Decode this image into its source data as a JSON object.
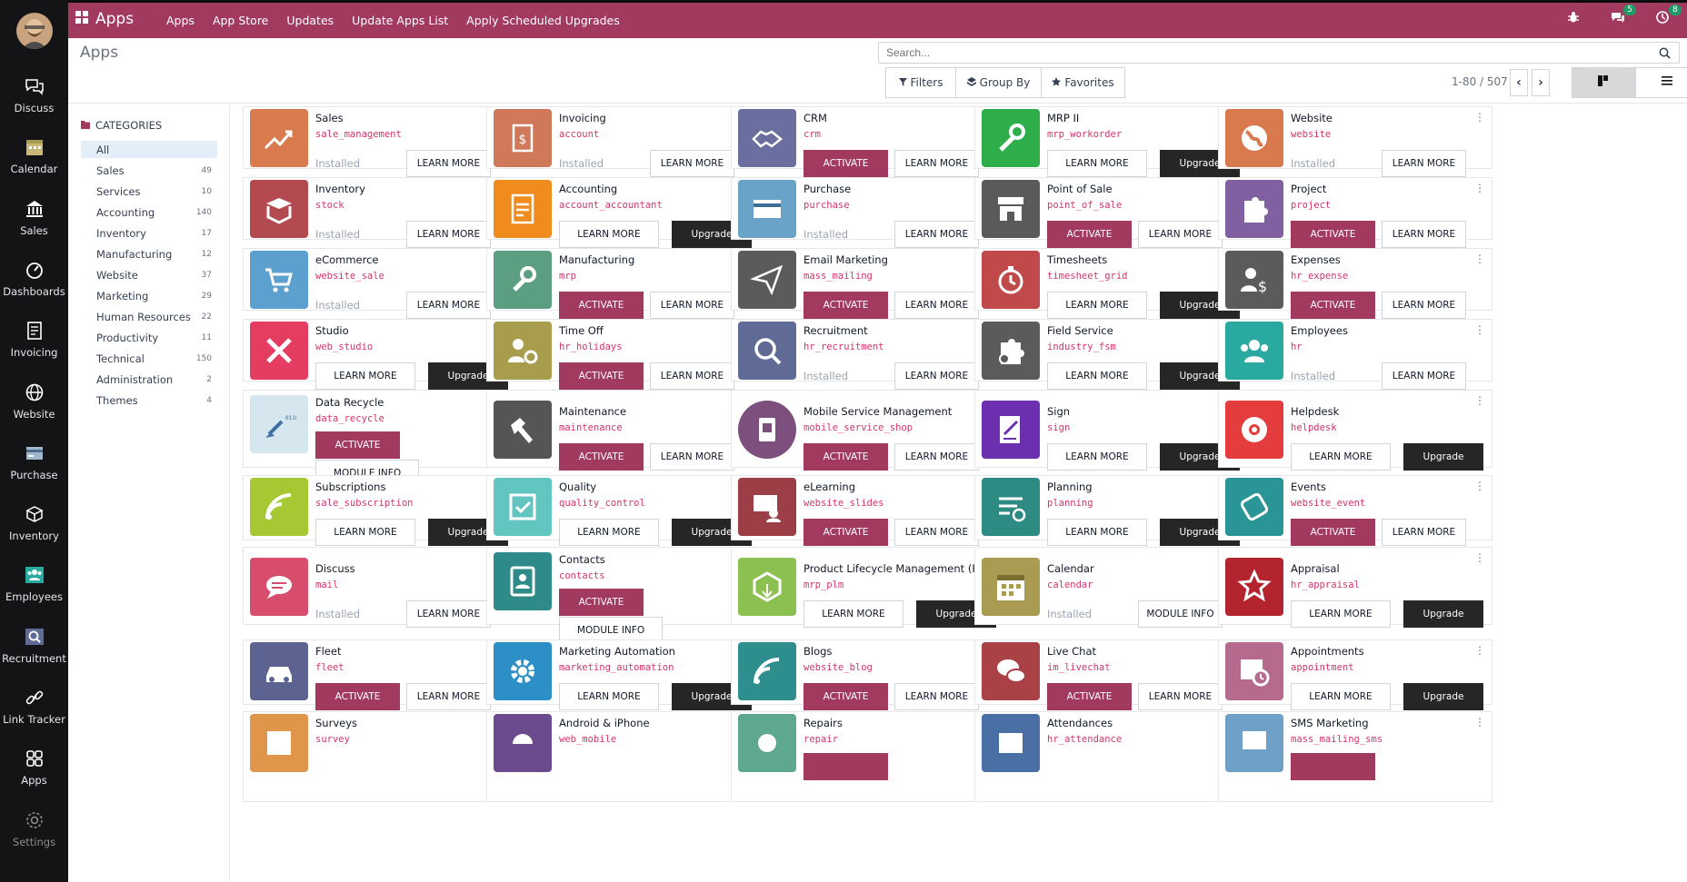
{
  "topbar": {
    "brand": "Apps",
    "nav": [
      "Apps",
      "App Store",
      "Updates",
      "Update Apps List",
      "Apply Scheduled Upgrades"
    ],
    "chat_badge": "5",
    "activity_badge": "8"
  },
  "leftbar": [
    {
      "label": "Discuss",
      "icon": "chat-icon"
    },
    {
      "label": "Calendar",
      "icon": "calendar-icon"
    },
    {
      "label": "Sales",
      "icon": "bank-icon"
    },
    {
      "label": "Dashboards",
      "icon": "gauge-icon"
    },
    {
      "label": "Invoicing",
      "icon": "invoice-icon"
    },
    {
      "label": "Website",
      "icon": "globe-icon"
    },
    {
      "label": "Purchase",
      "icon": "card-icon"
    },
    {
      "label": "Inventory",
      "icon": "box-icon"
    },
    {
      "label": "Employees",
      "icon": "people-icon"
    },
    {
      "label": "Recruitment",
      "icon": "search-icon"
    },
    {
      "label": "Link Tracker",
      "icon": "link-icon"
    },
    {
      "label": "Apps",
      "icon": "grid-icon"
    },
    {
      "label": "Settings",
      "icon": "gear-icon"
    }
  ],
  "breadcrumb": "Apps",
  "search": {
    "placeholder": "Search..."
  },
  "filters": {
    "filters": "Filters",
    "groupby": "Group By",
    "favorites": "Favorites"
  },
  "pager": "1-80 / 507",
  "sidebar": {
    "heading": "CATEGORIES",
    "items": [
      {
        "label": "All",
        "count": ""
      },
      {
        "label": "Sales",
        "count": "49"
      },
      {
        "label": "Services",
        "count": "10"
      },
      {
        "label": "Accounting",
        "count": "140"
      },
      {
        "label": "Inventory",
        "count": "17"
      },
      {
        "label": "Manufacturing",
        "count": "12"
      },
      {
        "label": "Website",
        "count": "37"
      },
      {
        "label": "Marketing",
        "count": "29"
      },
      {
        "label": "Human Resources",
        "count": "22"
      },
      {
        "label": "Productivity",
        "count": "11"
      },
      {
        "label": "Technical",
        "count": "150"
      },
      {
        "label": "Administration",
        "count": "2"
      },
      {
        "label": "Themes",
        "count": "4"
      }
    ]
  },
  "apps": [
    {
      "title": "Sales",
      "tech": "sale_management",
      "status": "installed",
      "b1": "Installed",
      "b2": "LEARN MORE",
      "color": "#d97b4f"
    },
    {
      "title": "Invoicing",
      "tech": "account",
      "status": "installed",
      "b1": "Installed",
      "b2": "LEARN MORE",
      "color": "#d0785a"
    },
    {
      "title": "CRM",
      "tech": "crm",
      "status": "activate",
      "b1": "ACTIVATE",
      "b2": "LEARN MORE",
      "color": "#6a6fa0"
    },
    {
      "title": "MRP II",
      "tech": "mrp_workorder",
      "status": "upgrade",
      "b1": "LEARN MORE",
      "b2": "Upgrade",
      "color": "#2eae4b"
    },
    {
      "title": "Website",
      "tech": "website",
      "status": "installed",
      "b1": "Installed",
      "b2": "LEARN MORE",
      "color": "#d87a4d"
    },
    {
      "title": "Inventory",
      "tech": "stock",
      "status": "installed",
      "b1": "Installed",
      "b2": "LEARN MORE",
      "color": "#b34a4f"
    },
    {
      "title": "Accounting",
      "tech": "account_accountant",
      "status": "upgrade",
      "b1": "LEARN MORE",
      "b2": "Upgrade",
      "color": "#f08c1e"
    },
    {
      "title": "Purchase",
      "tech": "purchase",
      "status": "installed",
      "b1": "Installed",
      "b2": "LEARN MORE",
      "color": "#69a4c8"
    },
    {
      "title": "Point of Sale",
      "tech": "point_of_sale",
      "status": "activate",
      "b1": "ACTIVATE",
      "b2": "LEARN MORE",
      "color": "#5a5a5a"
    },
    {
      "title": "Project",
      "tech": "project",
      "status": "activate",
      "b1": "ACTIVATE",
      "b2": "LEARN MORE",
      "color": "#8060a0"
    },
    {
      "title": "eCommerce",
      "tech": "website_sale",
      "status": "installed",
      "b1": "Installed",
      "b2": "LEARN MORE",
      "color": "#5ba0cf"
    },
    {
      "title": "Manufacturing",
      "tech": "mrp",
      "status": "activate",
      "b1": "ACTIVATE",
      "b2": "LEARN MORE",
      "color": "#5c9e82"
    },
    {
      "title": "Email Marketing",
      "tech": "mass_mailing",
      "status": "activate",
      "b1": "ACTIVATE",
      "b2": "LEARN MORE",
      "color": "#5b5b5b"
    },
    {
      "title": "Timesheets",
      "tech": "timesheet_grid",
      "status": "upgrade",
      "b1": "LEARN MORE",
      "b2": "Upgrade",
      "color": "#c04a4a"
    },
    {
      "title": "Expenses",
      "tech": "hr_expense",
      "status": "activate",
      "b1": "ACTIVATE",
      "b2": "LEARN MORE",
      "color": "#5b5b5b"
    },
    {
      "title": "Studio",
      "tech": "web_studio",
      "status": "upgrade",
      "b1": "LEARN MORE",
      "b2": "Upgrade",
      "color": "#e53d62"
    },
    {
      "title": "Time Off",
      "tech": "hr_holidays",
      "status": "activate",
      "b1": "ACTIVATE",
      "b2": "LEARN MORE",
      "color": "#a89c4d"
    },
    {
      "title": "Recruitment",
      "tech": "hr_recruitment",
      "status": "installed",
      "b1": "Installed",
      "b2": "LEARN MORE",
      "color": "#5f6a95"
    },
    {
      "title": "Field Service",
      "tech": "industry_fsm",
      "status": "upgrade",
      "b1": "LEARN MORE",
      "b2": "Upgrade",
      "color": "#5b5b5b"
    },
    {
      "title": "Employees",
      "tech": "hr",
      "status": "installed",
      "b1": "Installed",
      "b2": "LEARN MORE",
      "color": "#2aa9a0"
    },
    {
      "title": "Data Recycle",
      "tech": "data_recycle",
      "status": "activate-info",
      "b1": "ACTIVATE",
      "b2": "MODULE INFO",
      "color": "#d5e6ee"
    },
    {
      "title": "Maintenance",
      "tech": "maintenance",
      "status": "activate",
      "b1": "ACTIVATE",
      "b2": "LEARN MORE",
      "color": "#555555"
    },
    {
      "title": "Mobile Service Management",
      "tech": "mobile_service_shop",
      "status": "activate",
      "b1": "ACTIVATE",
      "b2": "LEARN MORE",
      "color": "#7c4f7c"
    },
    {
      "title": "Sign",
      "tech": "sign",
      "status": "upgrade",
      "b1": "LEARN MORE",
      "b2": "Upgrade",
      "color": "#6b2fb0"
    },
    {
      "title": "Helpdesk",
      "tech": "helpdesk",
      "status": "upgrade",
      "b1": "LEARN MORE",
      "b2": "Upgrade",
      "color": "#e53d3d"
    },
    {
      "title": "Subscriptions",
      "tech": "sale_subscription",
      "status": "upgrade",
      "b1": "LEARN MORE",
      "b2": "Upgrade",
      "color": "#a6c832"
    },
    {
      "title": "Quality",
      "tech": "quality_control",
      "status": "upgrade",
      "b1": "LEARN MORE",
      "b2": "Upgrade",
      "color": "#63c5bf"
    },
    {
      "title": "eLearning",
      "tech": "website_slides",
      "status": "activate",
      "b1": "ACTIVATE",
      "b2": "LEARN MORE",
      "color": "#9c3e45"
    },
    {
      "title": "Planning",
      "tech": "planning",
      "status": "upgrade",
      "b1": "LEARN MORE",
      "b2": "Upgrade",
      "color": "#2e8b84"
    },
    {
      "title": "Events",
      "tech": "website_event",
      "status": "activate",
      "b1": "ACTIVATE",
      "b2": "LEARN MORE",
      "color": "#2a9596"
    },
    {
      "title": "Discuss",
      "tech": "mail",
      "status": "installed",
      "b1": "Installed",
      "b2": "LEARN MORE",
      "color": "#d84d6c"
    },
    {
      "title": "Contacts",
      "tech": "contacts",
      "status": "activate-info",
      "b1": "ACTIVATE",
      "b2": "MODULE INFO",
      "color": "#2f8a8a"
    },
    {
      "title": "Product Lifecycle Management (PL...",
      "tech": "mrp_plm",
      "status": "upgrade",
      "b1": "LEARN MORE",
      "b2": "Upgrade",
      "color": "#8cc152"
    },
    {
      "title": "Calendar",
      "tech": "calendar",
      "status": "installed-info",
      "b1": "Installed",
      "b2": "MODULE INFO",
      "color": "#a99b52"
    },
    {
      "title": "Appraisal",
      "tech": "hr_appraisal",
      "status": "upgrade",
      "b1": "LEARN MORE",
      "b2": "Upgrade",
      "color": "#b3242e"
    },
    {
      "title": "Fleet",
      "tech": "fleet",
      "status": "activate",
      "b1": "ACTIVATE",
      "b2": "LEARN MORE",
      "color": "#5c6390"
    },
    {
      "title": "Marketing Automation",
      "tech": "marketing_automation",
      "status": "upgrade",
      "b1": "LEARN MORE",
      "b2": "Upgrade",
      "color": "#2c8fc6"
    },
    {
      "title": "Blogs",
      "tech": "website_blog",
      "status": "activate",
      "b1": "ACTIVATE",
      "b2": "LEARN MORE",
      "color": "#2e8d8d"
    },
    {
      "title": "Live Chat",
      "tech": "im_livechat",
      "status": "activate",
      "b1": "ACTIVATE",
      "b2": "LEARN MORE",
      "color": "#a94147"
    },
    {
      "title": "Appointments",
      "tech": "appointment",
      "status": "upgrade",
      "b1": "LEARN MORE",
      "b2": "Upgrade",
      "color": "#b66b8e"
    },
    {
      "title": "Surveys",
      "tech": "survey",
      "status": "partial",
      "b1": "",
      "b2": "",
      "color": "#e0964a"
    },
    {
      "title": "Android & iPhone",
      "tech": "web_mobile",
      "status": "partial",
      "b1": "",
      "b2": "",
      "color": "#6b4b8e"
    },
    {
      "title": "Repairs",
      "tech": "repair",
      "status": "partial",
      "b1": "",
      "b2": "",
      "color": "#5fa890"
    },
    {
      "title": "Attendances",
      "tech": "hr_attendance",
      "status": "partial",
      "b1": "",
      "b2": "",
      "color": "#4a6fa5"
    },
    {
      "title": "SMS Marketing",
      "tech": "mass_mailing_sms",
      "status": "partial",
      "b1": "",
      "b2": "",
      "color": "#6fa0c8"
    }
  ]
}
